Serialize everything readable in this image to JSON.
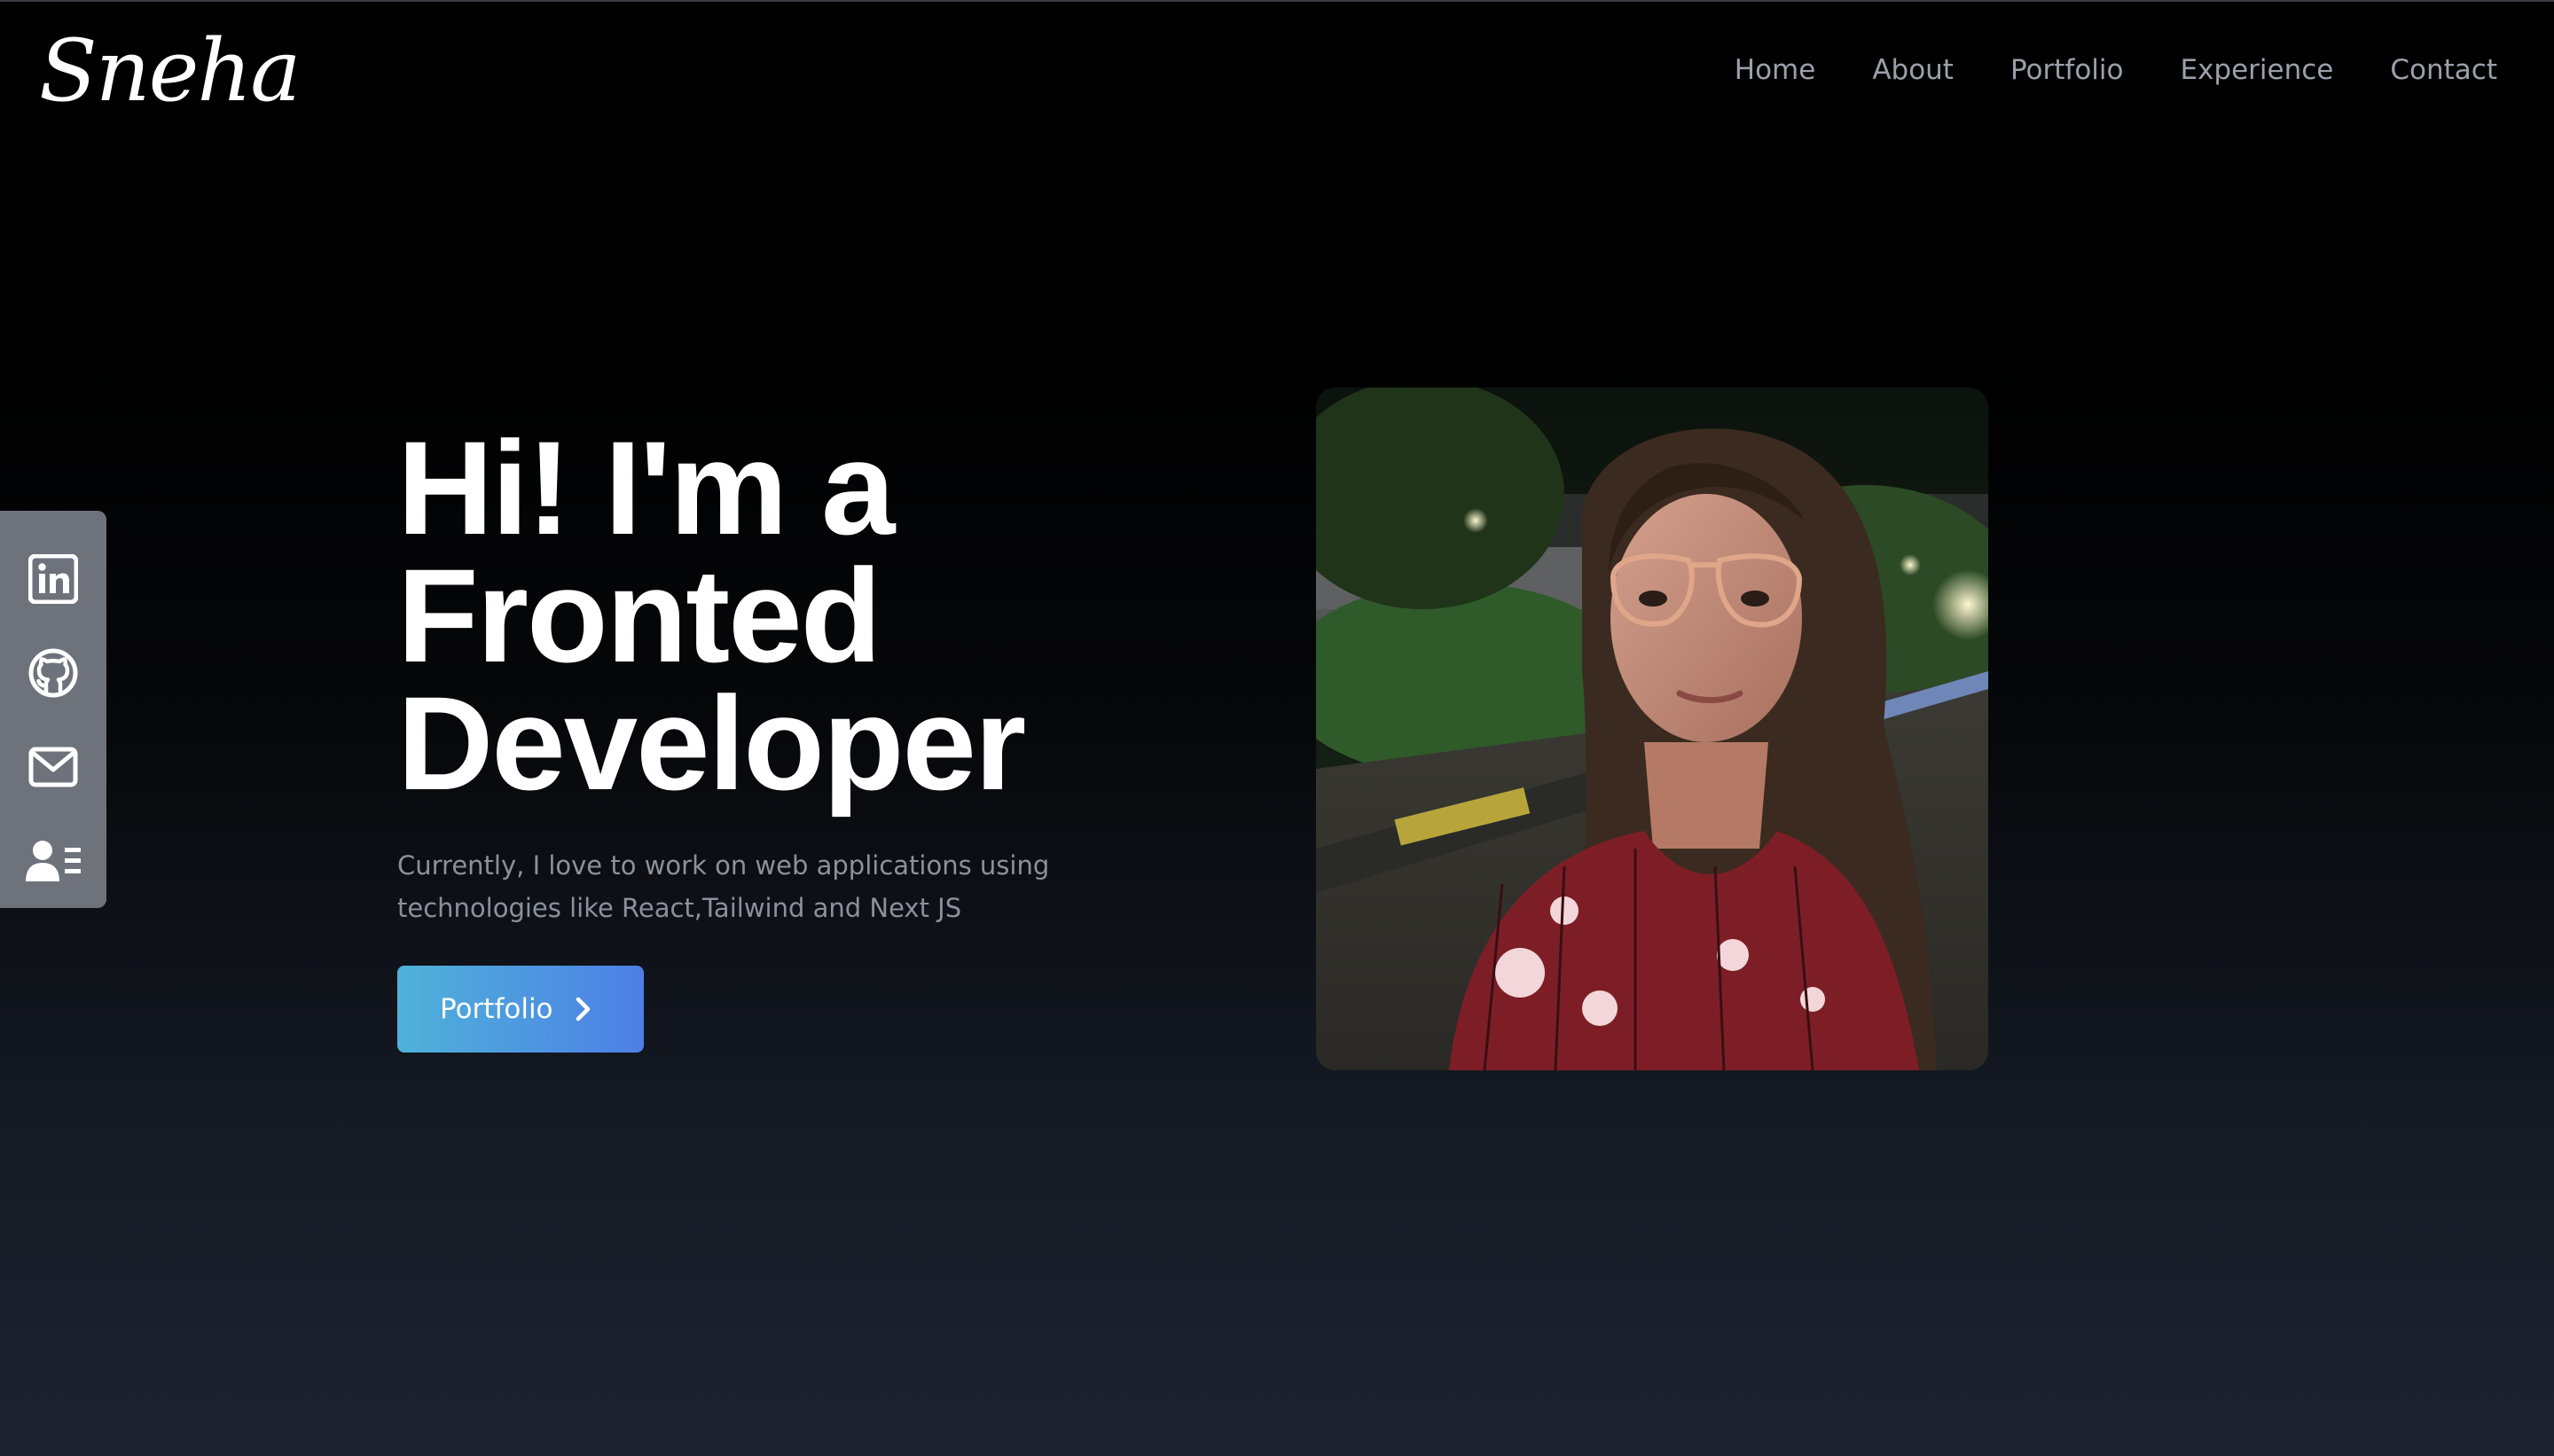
{
  "brand": {
    "logo_text": "Sneha"
  },
  "nav": {
    "items": [
      {
        "label": "Home"
      },
      {
        "label": "About"
      },
      {
        "label": "Portfolio"
      },
      {
        "label": "Experience"
      },
      {
        "label": "Contact"
      }
    ]
  },
  "social": {
    "items": [
      {
        "icon": "linkedin-icon"
      },
      {
        "icon": "github-icon"
      },
      {
        "icon": "mail-icon"
      },
      {
        "icon": "resume-icon"
      }
    ],
    "background": "#6e727b"
  },
  "hero": {
    "headline_line1": "Hi! I'm a",
    "headline_line2": "Fronted",
    "headline_line3": "Developer",
    "subtitle": "Currently, I love to work on web applications using technologies like React,Tailwind and Next JS",
    "cta_label": "Portfolio",
    "cta_icon": "chevron-right-icon"
  },
  "photo": {
    "subject": "profile-photo"
  },
  "colors": {
    "background_top": "#000000",
    "background_bottom": "#1d2330",
    "nav_text": "#9aa0ab",
    "subtitle_text": "#8b919c",
    "cta_gradient_start": "#4fb2d9",
    "cta_gradient_end": "#4d7fe6"
  }
}
